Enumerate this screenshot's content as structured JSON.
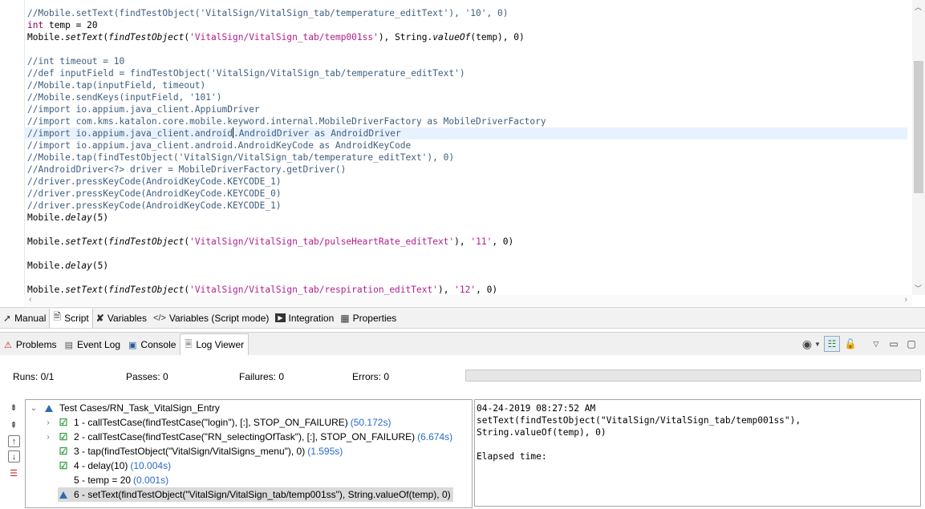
{
  "editor": {
    "lines": [
      {
        "type": "comment",
        "text": "//Mobile.setText(findTestObject('VitalSign/VitalSign_tab/temperature_editText'), '10', 0)"
      },
      {
        "type": "code",
        "segments": [
          {
            "t": "int",
            "s": "kw"
          },
          {
            "t": " temp = 20",
            "s": ""
          }
        ]
      },
      {
        "type": "code",
        "segments": [
          {
            "t": "Mobile.",
            "s": ""
          },
          {
            "t": "setText",
            "s": "it"
          },
          {
            "t": "(",
            "s": ""
          },
          {
            "t": "findTestObject",
            "s": "it"
          },
          {
            "t": "(",
            "s": ""
          },
          {
            "t": "'VitalSign/VitalSign_tab/temp001ss'",
            "s": "str"
          },
          {
            "t": "), String.",
            "s": ""
          },
          {
            "t": "valueOf",
            "s": "it"
          },
          {
            "t": "(temp), 0)",
            "s": ""
          }
        ]
      },
      {
        "type": "blank",
        "text": ""
      },
      {
        "type": "comment",
        "text": "//int timeout = 10"
      },
      {
        "type": "comment",
        "text": "//def inputField = findTestObject('VitalSign/VitalSign_tab/temperature_editText')"
      },
      {
        "type": "comment",
        "text": "//Mobile.tap(inputField, timeout)"
      },
      {
        "type": "comment",
        "text": "//Mobile.sendKeys(inputField, '101')"
      },
      {
        "type": "comment",
        "text": "//import io.appium.java_client.AppiumDriver"
      },
      {
        "type": "comment",
        "text": "//import com.kms.katalon.core.mobile.keyword.internal.MobileDriverFactory as MobileDriverFactory"
      },
      {
        "type": "current",
        "before": "//import io.appium.java_client.android",
        "after": ".AndroidDriver as AndroidDriver"
      },
      {
        "type": "comment",
        "text": "//import io.appium.java_client.android.AndroidKeyCode as AndroidKeyCode"
      },
      {
        "type": "comment",
        "text": "//Mobile.tap(findTestObject('VitalSign/VitalSign_tab/temperature_editText'), 0)"
      },
      {
        "type": "comment",
        "text": "//AndroidDriver<?> driver = MobileDriverFactory.getDriver()"
      },
      {
        "type": "comment",
        "text": "//driver.pressKeyCode(AndroidKeyCode.KEYCODE_1)"
      },
      {
        "type": "comment",
        "text": "//driver.pressKeyCode(AndroidKeyCode.KEYCODE_0)"
      },
      {
        "type": "comment",
        "text": "//driver.pressKeyCode(AndroidKeyCode.KEYCODE_1)"
      },
      {
        "type": "code",
        "segments": [
          {
            "t": "Mobile.",
            "s": ""
          },
          {
            "t": "delay",
            "s": "it"
          },
          {
            "t": "(5)",
            "s": ""
          }
        ]
      },
      {
        "type": "blank",
        "text": ""
      },
      {
        "type": "code",
        "segments": [
          {
            "t": "Mobile.",
            "s": ""
          },
          {
            "t": "setText",
            "s": "it"
          },
          {
            "t": "(",
            "s": ""
          },
          {
            "t": "findTestObject",
            "s": "it"
          },
          {
            "t": "(",
            "s": ""
          },
          {
            "t": "'VitalSign/VitalSign_tab/pulseHeartRate_editText'",
            "s": "str"
          },
          {
            "t": "), ",
            "s": ""
          },
          {
            "t": "'11'",
            "s": "str"
          },
          {
            "t": ", 0)",
            "s": ""
          }
        ]
      },
      {
        "type": "blank",
        "text": ""
      },
      {
        "type": "code",
        "segments": [
          {
            "t": "Mobile.",
            "s": ""
          },
          {
            "t": "delay",
            "s": "it"
          },
          {
            "t": "(5)",
            "s": ""
          }
        ]
      },
      {
        "type": "blank",
        "text": ""
      },
      {
        "type": "code",
        "segments": [
          {
            "t": "Mobile.",
            "s": ""
          },
          {
            "t": "setText",
            "s": "it"
          },
          {
            "t": "(",
            "s": ""
          },
          {
            "t": "findTestObject",
            "s": "it"
          },
          {
            "t": "(",
            "s": ""
          },
          {
            "t": "'VitalSign/VitalSign_tab/respiration_editText'",
            "s": "str"
          },
          {
            "t": "), ",
            "s": ""
          },
          {
            "t": "'12'",
            "s": "str"
          },
          {
            "t": ", 0)",
            "s": ""
          }
        ]
      }
    ]
  },
  "mode_tabs": [
    {
      "label": "Manual",
      "icon": "pointer-icon",
      "glyph": "➚",
      "active": false
    },
    {
      "label": "Script",
      "icon": "script-icon",
      "glyph": "🗎",
      "active": true
    },
    {
      "label": "Variables",
      "icon": "variables-icon",
      "glyph": "✘",
      "active": false
    },
    {
      "label": "Variables (Script mode)",
      "icon": "code-brackets-icon",
      "glyph": "</>",
      "active": false
    },
    {
      "label": "Integration",
      "icon": "integration-icon",
      "glyph": "▶",
      "active": false
    },
    {
      "label": "Properties",
      "icon": "properties-icon",
      "glyph": "▦",
      "active": false
    }
  ],
  "panel_tabs": [
    {
      "label": "Problems",
      "icon": "problems-icon",
      "glyph": "⚠",
      "active": false
    },
    {
      "label": "Event Log",
      "icon": "event-log-icon",
      "glyph": "▤",
      "active": false
    },
    {
      "label": "Console",
      "icon": "console-icon",
      "glyph": "▣",
      "active": false
    },
    {
      "label": "Log Viewer",
      "icon": "log-viewer-icon",
      "glyph": "🗏",
      "active": true
    }
  ],
  "stats": {
    "runs": "Runs: 0/1",
    "passes": "Passes: 0",
    "failures": "Failures: 0",
    "errors": "Errors: 0",
    "progress": 0
  },
  "tree": {
    "root": "Test Cases/RN_Task_VitalSign_Entry",
    "items": [
      {
        "label": "1 - callTestCase(findTestCase(\"login\"), [:], STOP_ON_FAILURE)",
        "duration": "(50.172s)",
        "status": "passed",
        "expandable": true
      },
      {
        "label": "2 - callTestCase(findTestCase(\"RN_selectingOfTask\"), [:], STOP_ON_FAILURE)",
        "duration": "(6.674s)",
        "status": "passed",
        "expandable": true
      },
      {
        "label": "3 - tap(findTestObject(\"VitalSign/VitalSigns_menu\"), 0)",
        "duration": "(1.595s)",
        "status": "passed",
        "expandable": false
      },
      {
        "label": "4 - delay(10)",
        "duration": "(10.004s)",
        "status": "passed",
        "expandable": false
      },
      {
        "label": "5 - temp = 20",
        "duration": "(0.001s)",
        "status": "none",
        "expandable": false
      },
      {
        "label": "6 - setText(findTestObject(\"VitalSign/VitalSign_tab/temp001ss\"), String.valueOf(temp), 0)",
        "duration": "",
        "status": "running",
        "expandable": false
      }
    ]
  },
  "log_detail": {
    "timestamp": "04-24-2019 08:27:52 AM",
    "message_line1": "setText(findTestObject(\"VitalSign/VitalSign_tab/temp001ss\"),",
    "message_line2": "String.valueOf(temp), 0)",
    "elapsed": "Elapsed time:"
  }
}
